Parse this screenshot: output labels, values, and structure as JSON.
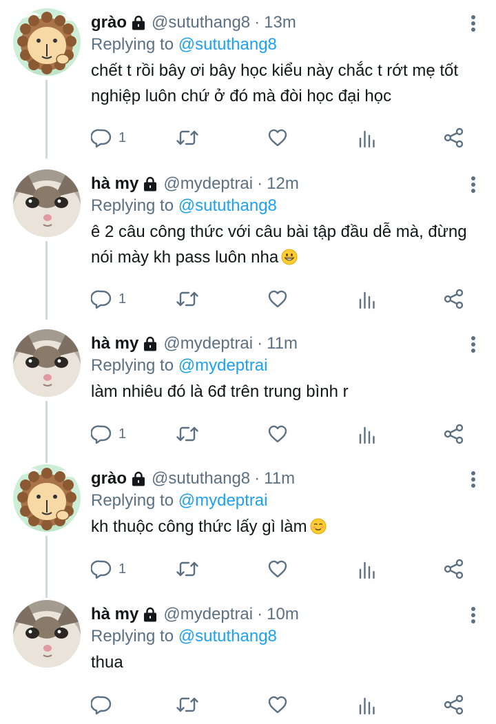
{
  "colors": {
    "text": "#14171a",
    "secondary": "#5b7083",
    "accent": "#1da1f2",
    "thread_line": "#cfd9de"
  },
  "tweets": [
    {
      "avatar": "lion-avatar",
      "name": "grào",
      "handle": "@sututhang8",
      "time": "13m",
      "replying_label": "Replying to",
      "replying_to": "@sututhang8",
      "text": "chết t rồi bây ơi bây học kiểu này chắc t rớt mẹ tốt nghiệp luôn chứ ở đó mà đòi học đại học",
      "emoji": "",
      "reply_count": "1"
    },
    {
      "avatar": "cat-avatar",
      "name": "hà my",
      "handle": "@mydeptrai",
      "time": "12m",
      "replying_label": "Replying to",
      "replying_to": "@sututhang8",
      "text": "ê 2 câu công thức với câu bài tập đầu dễ mà, đừng nói mày kh pass luôn nha",
      "emoji": "grinning-face",
      "reply_count": "1"
    },
    {
      "avatar": "cat-avatar",
      "name": "hà my",
      "handle": "@mydeptrai",
      "time": "11m",
      "replying_label": "Replying to",
      "replying_to": "@mydeptrai",
      "text": "làm nhiêu đó là 6đ trên trung bình r",
      "emoji": "",
      "reply_count": "1"
    },
    {
      "avatar": "lion-avatar",
      "name": "grào",
      "handle": "@sututhang8",
      "time": "11m",
      "replying_label": "Replying to",
      "replying_to": "@mydeptrai",
      "text": "kh thuộc công thức lấy gì làm",
      "emoji": "smiling-face",
      "reply_count": "1"
    },
    {
      "avatar": "cat-avatar",
      "name": "hà my",
      "handle": "@mydeptrai",
      "time": "10m",
      "replying_label": "Replying to",
      "replying_to": "@sututhang8",
      "text": "thua",
      "emoji": "",
      "reply_count": ""
    }
  ],
  "dot_separator": "·"
}
